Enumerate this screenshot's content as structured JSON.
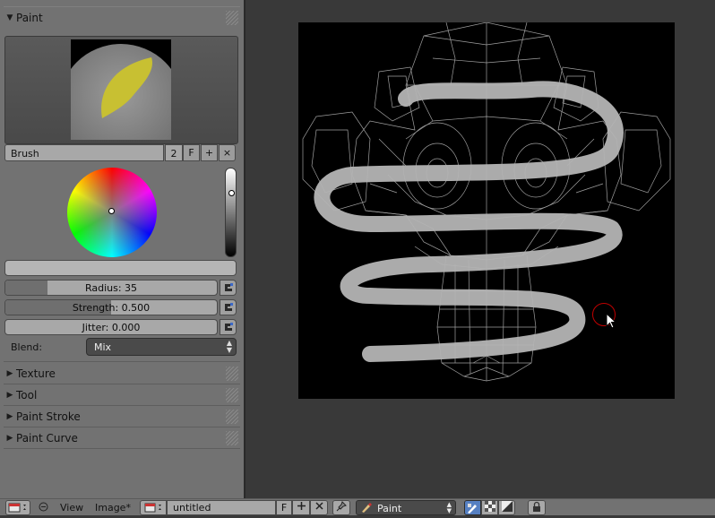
{
  "panel": {
    "paint_header": "Paint",
    "brush": {
      "name": "Brush",
      "users": "2",
      "fake_user": "F",
      "add": "+",
      "remove": "×"
    },
    "sliders": [
      {
        "label": "Radius: 35",
        "fill": 0.2
      },
      {
        "label": "Strength: 0.500",
        "fill": 0.5
      },
      {
        "label": "Jitter: 0.000",
        "fill": 0.0
      }
    ],
    "blend": {
      "label": "Blend:",
      "value": "Mix"
    },
    "collapsed_panels": [
      "Texture",
      "Tool",
      "Paint Stroke",
      "Paint Curve"
    ]
  },
  "bottom_bar": {
    "menus": [
      "View",
      "Image*"
    ],
    "image_name": "untitled",
    "fake_user": "F",
    "mode": "Paint"
  },
  "colors": {
    "panel_bg": "#727272",
    "viewport_bg": "#393939",
    "stroke": "#b4b4b4",
    "brush_cursor": "#c00000",
    "paint_yellow": "#c8c032"
  },
  "icons": [
    "image-editor-icon",
    "minus-icon",
    "image-browse-icon",
    "plus-icon",
    "close-icon",
    "pin-icon",
    "paint-brush-icon",
    "checker-icon",
    "alpha-icon",
    "lock-icon",
    "pressure-icon"
  ]
}
